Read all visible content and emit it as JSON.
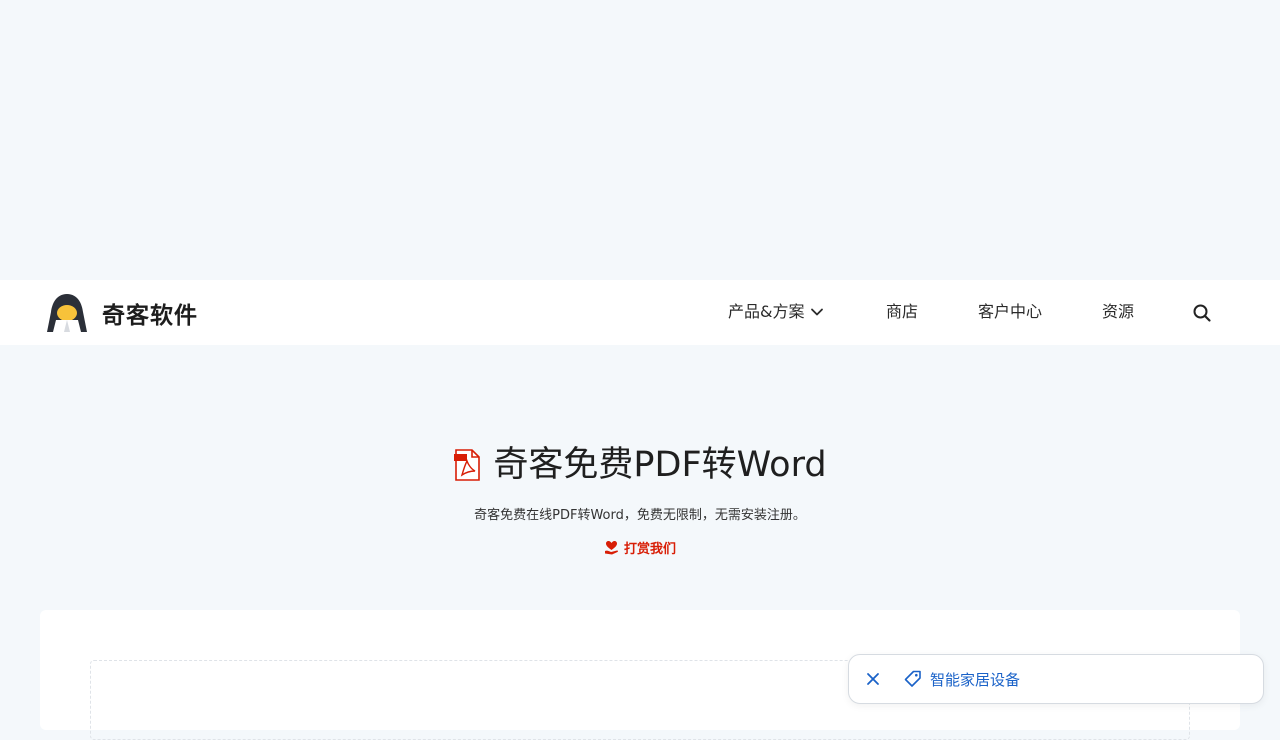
{
  "header": {
    "brand_name": "奇客软件",
    "nav": {
      "products": "产品&方案",
      "store": "商店",
      "customer_center": "客户中心",
      "resources": "资源"
    }
  },
  "hero": {
    "title": "奇客免费PDF转Word",
    "subtitle": "奇客免费在线PDF转Word，免费无限制，无需安装注册。",
    "donate_label": "打赏我们"
  },
  "floating_tag": {
    "label": "智能家居设备"
  },
  "colors": {
    "page_bg": "#f4f8fb",
    "accent_red": "#d81e06",
    "link_blue": "#1a62c8"
  },
  "icons": {
    "brand": "hacker-avatar-icon",
    "dropdown": "chevron-down-icon",
    "search": "search-icon",
    "pdf": "pdf-file-icon",
    "donate": "hand-heart-icon",
    "close": "close-icon",
    "tag": "tag-icon"
  }
}
